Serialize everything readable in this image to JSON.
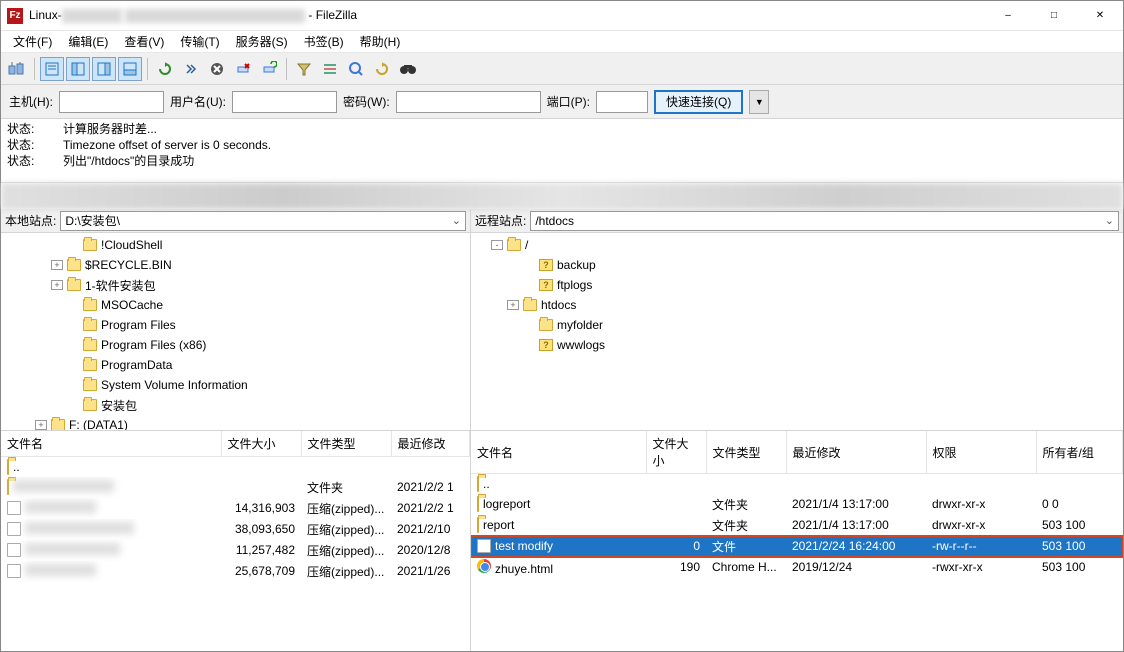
{
  "title_prefix": "Linux-",
  "title_suffix": " - FileZilla",
  "menu": [
    "文件(F)",
    "编辑(E)",
    "查看(V)",
    "传输(T)",
    "服务器(S)",
    "书签(B)",
    "帮助(H)"
  ],
  "qc": {
    "host_label": "主机(H):",
    "user_label": "用户名(U):",
    "pass_label": "密码(W):",
    "port_label": "端口(P):",
    "btn": "快速连接(Q)"
  },
  "status": [
    {
      "tag": "状态:",
      "msg": "计算服务器时差..."
    },
    {
      "tag": "状态:",
      "msg": "Timezone offset of server is 0 seconds."
    },
    {
      "tag": "状态:",
      "msg": "列出\"/htdocs\"的目录成功"
    }
  ],
  "local": {
    "label": "本地站点:",
    "path": "D:\\安装包\\",
    "tree": [
      {
        "indent": 46,
        "exp": "",
        "icon": "folder",
        "name": "!CloudShell"
      },
      {
        "indent": 30,
        "exp": "+",
        "icon": "folder",
        "name": "$RECYCLE.BIN"
      },
      {
        "indent": 30,
        "exp": "+",
        "icon": "folder",
        "name": "1-软件安装包"
      },
      {
        "indent": 46,
        "exp": "",
        "icon": "folder",
        "name": "MSOCache"
      },
      {
        "indent": 46,
        "exp": "",
        "icon": "folder",
        "name": "Program Files"
      },
      {
        "indent": 46,
        "exp": "",
        "icon": "folder",
        "name": "Program Files (x86)"
      },
      {
        "indent": 46,
        "exp": "",
        "icon": "folder",
        "name": "ProgramData"
      },
      {
        "indent": 46,
        "exp": "",
        "icon": "folder",
        "name": "System Volume Information"
      },
      {
        "indent": 46,
        "exp": "",
        "icon": "folder",
        "name": "安装包"
      },
      {
        "indent": 14,
        "exp": "+",
        "icon": "folder",
        "name": "F: (DATA1)"
      }
    ],
    "cols": [
      "文件名",
      "文件大小",
      "文件类型",
      "最近修改"
    ],
    "rows": [
      {
        "name": "..",
        "icon": "folder",
        "size": "",
        "type": "",
        "mod": ""
      },
      {
        "name": "[blurred]",
        "icon": "folder",
        "blur": true,
        "size": "",
        "type": "文件夹",
        "mod": "2021/2/2 1"
      },
      {
        "name": "[blurred]",
        "icon": "file",
        "blur": true,
        "size": "14,316,903",
        "type": "压缩(zipped)...",
        "mod": "2021/2/2 1"
      },
      {
        "name": "[blurred]",
        "icon": "file",
        "blur": true,
        "size": "38,093,650",
        "type": "压缩(zipped)...",
        "mod": "2021/2/10"
      },
      {
        "name": "[blurred]",
        "icon": "file",
        "blur": true,
        "size": "11,257,482",
        "type": "压缩(zipped)...",
        "mod": "2020/12/8"
      },
      {
        "name": "[blurred]",
        "icon": "file",
        "blur": true,
        "size": "25,678,709",
        "type": "压缩(zipped)...",
        "mod": "2021/1/26"
      }
    ]
  },
  "remote": {
    "label": "远程站点:",
    "path": "/htdocs",
    "tree": [
      {
        "indent": 0,
        "exp": "-",
        "icon": "folder",
        "name": "/"
      },
      {
        "indent": 32,
        "exp": "",
        "icon": "q",
        "name": "backup"
      },
      {
        "indent": 32,
        "exp": "",
        "icon": "q",
        "name": "ftplogs"
      },
      {
        "indent": 16,
        "exp": "+",
        "icon": "folder",
        "name": "htdocs"
      },
      {
        "indent": 32,
        "exp": "",
        "icon": "folder",
        "name": "myfolder"
      },
      {
        "indent": 32,
        "exp": "",
        "icon": "q",
        "name": "wwwlogs"
      }
    ],
    "cols": [
      "文件名",
      "文件大小",
      "文件类型",
      "最近修改",
      "权限",
      "所有者/组"
    ],
    "rows": [
      {
        "name": "..",
        "icon": "folder",
        "size": "",
        "type": "",
        "mod": "",
        "perm": "",
        "own": ""
      },
      {
        "name": "logreport",
        "icon": "folder",
        "size": "",
        "type": "文件夹",
        "mod": "2021/1/4 13:17:00",
        "perm": "drwxr-xr-x",
        "own": "0 0"
      },
      {
        "name": "report",
        "icon": "folder",
        "size": "",
        "type": "文件夹",
        "mod": "2021/1/4 13:17:00",
        "perm": "drwxr-xr-x",
        "own": "503 100"
      },
      {
        "name": "test modify",
        "icon": "file",
        "size": "0",
        "type": "文件",
        "mod": "2021/2/24 16:24:00",
        "perm": "-rw-r--r--",
        "own": "503 100",
        "selected": true
      },
      {
        "name": "zhuye.html",
        "icon": "chrome",
        "size": "190",
        "type": "Chrome H...",
        "mod": "2019/12/24",
        "perm": "-rwxr-xr-x",
        "own": "503 100"
      }
    ]
  }
}
